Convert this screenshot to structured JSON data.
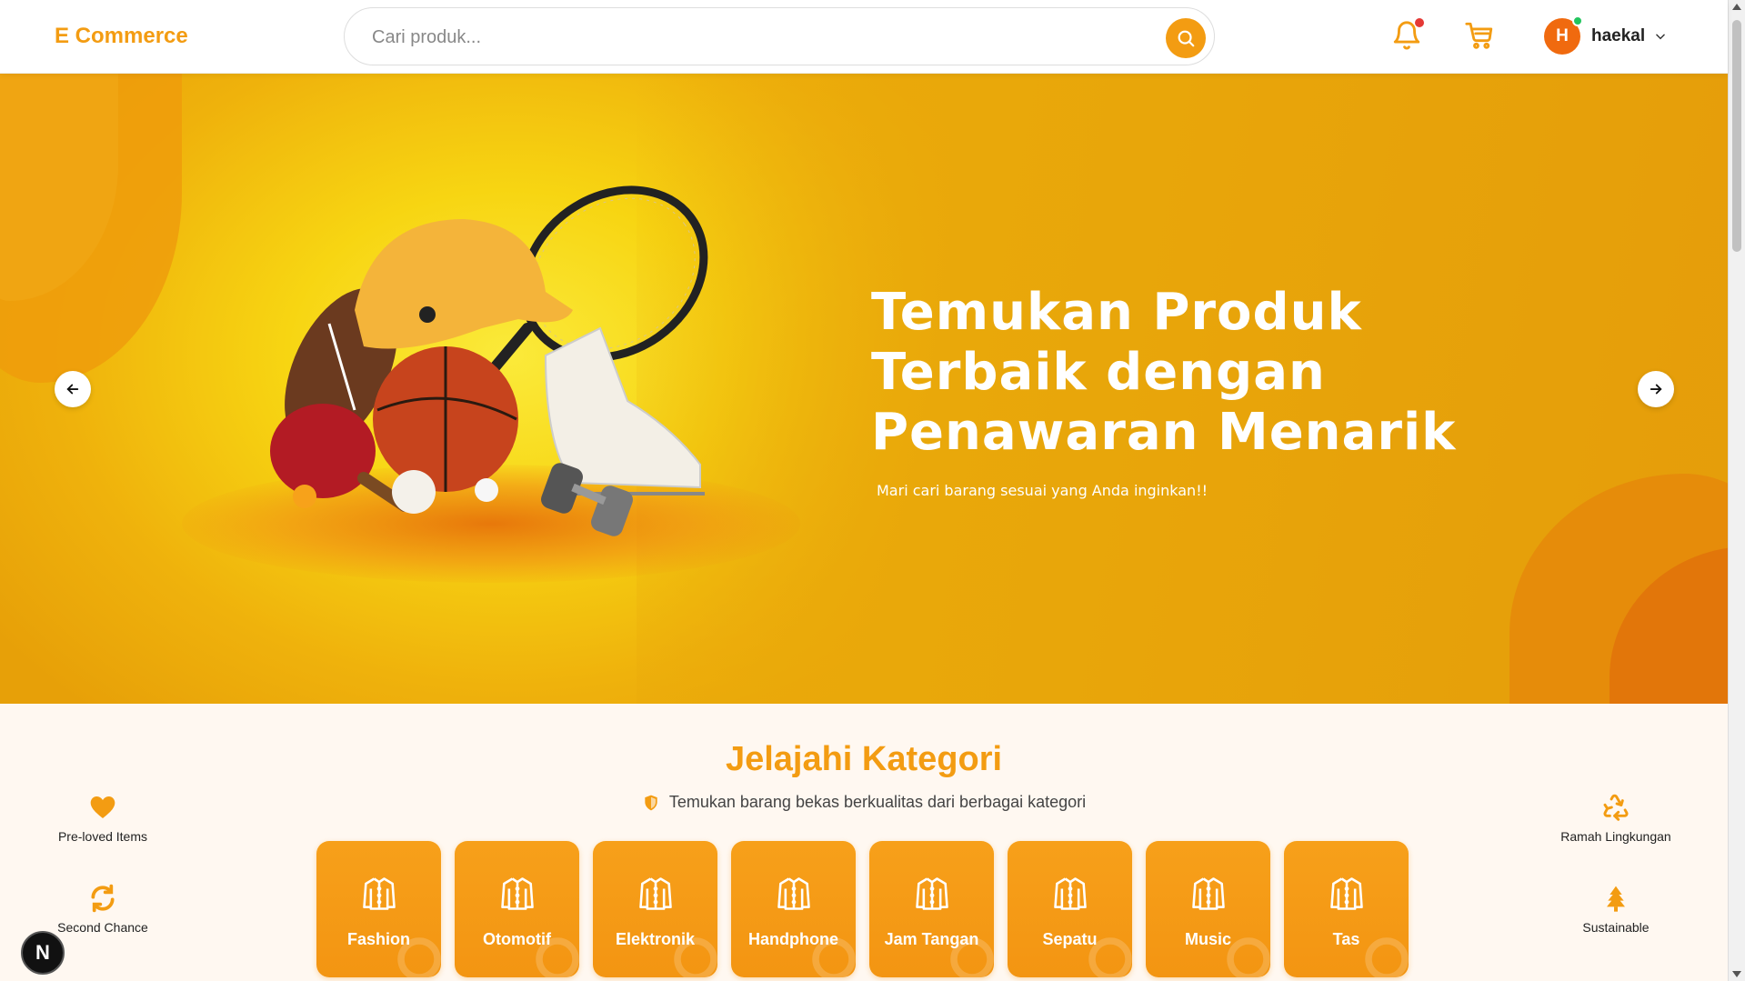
{
  "header": {
    "brand": "E Commerce",
    "search_placeholder": "Cari produk...",
    "user_initial": "H",
    "username": "haekal",
    "accent": "#f39c12"
  },
  "hero": {
    "title_lines": [
      "Temukan Produk",
      "Terbaik dengan",
      "Penawaran Menarik"
    ],
    "subtitle": "Mari cari barang sesuai yang Anda inginkan!!"
  },
  "categories_section": {
    "title": "Jelajahi Kategori",
    "subtitle": "Temukan barang bekas berkualitas dari berbagai kategori",
    "features_left": [
      {
        "label": "Pre-loved Items",
        "icon": "heart-icon"
      },
      {
        "label": "Second Chance",
        "icon": "refresh-icon"
      }
    ],
    "features_right": [
      {
        "label": "Ramah Lingkungan",
        "icon": "recycle-icon"
      },
      {
        "label": "Sustainable",
        "icon": "tree-icon"
      }
    ],
    "categories": [
      {
        "label": "Fashion"
      },
      {
        "label": "Otomotif"
      },
      {
        "label": "Elektronik"
      },
      {
        "label": "Handphone"
      },
      {
        "label": "Jam Tangan"
      },
      {
        "label": "Sepatu"
      },
      {
        "label": "Music"
      },
      {
        "label": "Tas"
      }
    ]
  },
  "dev_badge": "N"
}
